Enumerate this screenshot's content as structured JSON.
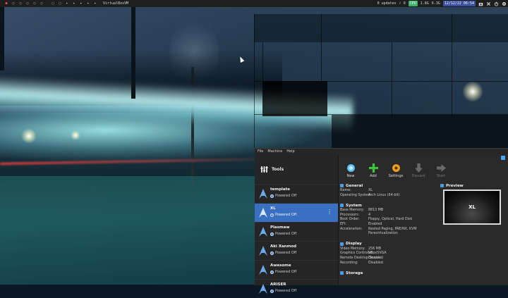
{
  "panel": {
    "workspaces": [
      "●",
      "○",
      "○",
      "○",
      "○",
      "○"
    ],
    "layout_icons": [
      "▢",
      "▢",
      "▸",
      "▸",
      "▸",
      "▸",
      "▸"
    ],
    "window_title": "VirtualBoxVM",
    "updates": "0 updates",
    "volume": "0",
    "cpu": "CPU",
    "cpu_value": "1.8G",
    "mem": "6.3G",
    "datetime": "12/12/22 06:54"
  },
  "vbox": {
    "menu": [
      "File",
      "Machine",
      "Help"
    ],
    "tools_label": "Tools",
    "vms": [
      {
        "name": "template",
        "state": "Powered Off",
        "selected": false
      },
      {
        "name": "XL",
        "state": "Powered Off",
        "selected": true
      },
      {
        "name": "Plasmaw",
        "state": "Powered Off",
        "selected": false
      },
      {
        "name": "Aki Xanmod",
        "state": "Powered Off",
        "selected": false
      },
      {
        "name": "Awesome",
        "state": "Powered Off",
        "selected": false
      },
      {
        "name": "ARISER",
        "state": "Powered Off",
        "selected": false
      }
    ],
    "toolbar": {
      "new": "New",
      "add": "Add",
      "settings": "Settings",
      "discard": "Discard",
      "start": "Start"
    },
    "general": {
      "title": "General",
      "rows": [
        {
          "k": "Name:",
          "v": "XL"
        },
        {
          "k": "Operating System:",
          "v": "Arch Linux (64-bit)"
        }
      ]
    },
    "system": {
      "title": "System",
      "rows": [
        {
          "k": "Base Memory:",
          "v": "8813 MB"
        },
        {
          "k": "Processors:",
          "v": "4"
        },
        {
          "k": "Boot Order:",
          "v": "Floppy, Optical, Hard Disk"
        },
        {
          "k": "EFI:",
          "v": "Enabled"
        },
        {
          "k": "Acceleration:",
          "v": "Nested Paging, PAE/NX, KVM"
        },
        {
          "k": "",
          "v": "Paravirtualization"
        }
      ]
    },
    "display": {
      "title": "Display",
      "rows": [
        {
          "k": "Video Memory:",
          "v": "256 MB"
        },
        {
          "k": "Graphics Controller:",
          "v": "VBoxSVGA"
        },
        {
          "k": "Remote Desktop Server:",
          "v": "Disabled"
        },
        {
          "k": "Recording:",
          "v": "Disabled"
        }
      ]
    },
    "storage": {
      "title": "Storage"
    },
    "preview": {
      "title": "Preview",
      "screen_text": "XL"
    }
  }
}
